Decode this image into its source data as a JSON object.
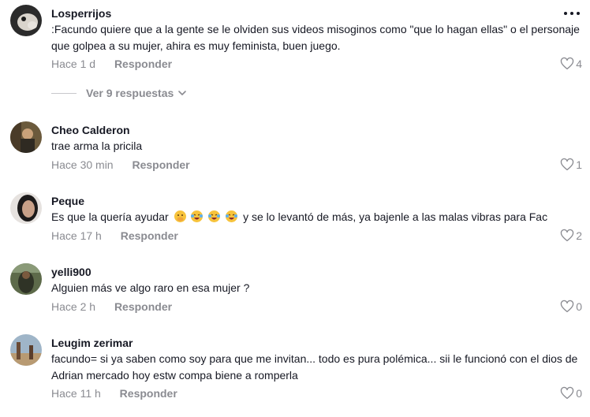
{
  "more_menu_label": "•••",
  "first_comment": {
    "author": "Losperrijos",
    "text": ":Facundo quiere que a la gente se le olviden sus videos misoginos como \"que lo hagan ellas\" o el personaje que golpea a su mujer, ahira es muy feminista, buen juego.",
    "time": "Hace 1 d",
    "reply": "Responder",
    "likes": "4",
    "view_replies": "Ver 9 respuestas"
  },
  "comments": [
    {
      "author": "Cheo Calderon",
      "text": "trae arma la pricila",
      "time": "Hace 30 min",
      "reply": "Responder",
      "likes": "1"
    },
    {
      "author": "Peque",
      "text_before": "Es que la quería ayudar",
      "text_after": "y se lo levantó de más, ya bajenle a las malas vibras para Fac",
      "emojis": [
        "face-with-hand-over-mouth-emoji",
        "laughing-emoji",
        "laughing-emoji",
        "laughing-emoji"
      ],
      "time": "Hace 17 h",
      "reply": "Responder",
      "likes": "2"
    },
    {
      "author": "yelli900",
      "text": "Alguien más ve algo raro en esa mujer ?",
      "time": "Hace 2 h",
      "reply": "Responder",
      "likes": "0"
    },
    {
      "author": "Leugim zerimar",
      "text": "facundo= si ya saben como soy para que me invitan... todo es pura polémica... sii le funcionó con el dios de Adrian mercado hoy estw compa biene a romperla",
      "time": "Hace 11 h",
      "reply": "Responder",
      "likes": "0"
    }
  ],
  "colors": {
    "text": "#161823",
    "muted": "#8a8b91",
    "background": "#ffffff"
  }
}
